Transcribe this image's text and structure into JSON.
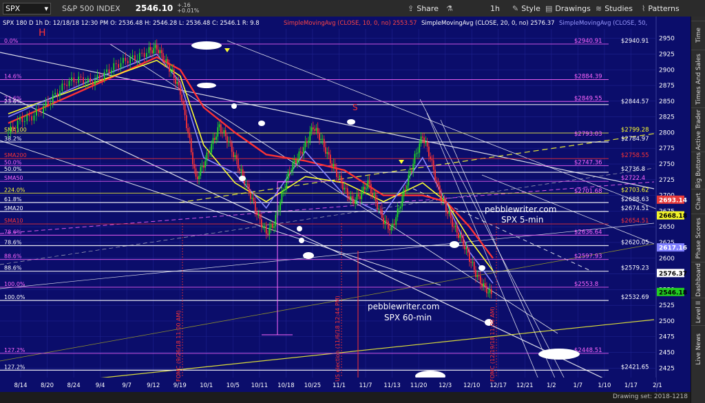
{
  "toolbar": {
    "symbol": "SPX",
    "name": "S&P 500 INDEX",
    "price": "2546.10",
    "change": "+.16",
    "change_pct": "+0.01%",
    "share": "Share",
    "interval": "1h",
    "style": "Style",
    "drawings": "Drawings",
    "studies": "Studies",
    "patterns": "Patterns"
  },
  "legend": {
    "ohlc": "SPX 180 D 1h   D: 12/18/18 12:30 PM   O: 2536.48   H: 2546.28   L: 2536.48   C: 2546.1   R: 9.8",
    "sma10": "SimpleMovingAvg (CLOSE, 10, 0, no)  2553.57",
    "sma20": "SimpleMovingAvg (CLOSE, 20, 0, no)  2576.37",
    "sma50": "SimpleMovingAvg (CLOSE, 50,"
  },
  "sidebar": {
    "tabs": [
      "Time",
      "Times And Sales",
      "Active Trader",
      "Big Buttons",
      "Chart",
      "Phase Scores",
      "Dashboard",
      "Level II",
      "Live News"
    ]
  },
  "status": {
    "drawing_set": "Drawing set: 2018-1218"
  },
  "annotations": {
    "h_mark": "H",
    "s_mark": "S",
    "watermark_5min": [
      "pebblewriter.com",
      "SPX 5-min"
    ],
    "watermark_60min": [
      "pebblewriter.com",
      "SPX 60-min"
    ],
    "fomc_sep": "FOMC (9/26/18 11:00 AM)",
    "us_election": "US election (11/6/18 12:44 PM)",
    "fomc_dec": "FOMC (12/19/18 11:00 AM)"
  },
  "chart_data": {
    "type": "candlestick",
    "ylim": [
      2410,
      2965
    ],
    "yticks": [
      2425,
      2450,
      2475,
      2500,
      2525,
      2550,
      2575,
      2600,
      2625,
      2650,
      2675,
      2700,
      2725,
      2750,
      2775,
      2800,
      2825,
      2850,
      2875,
      2900,
      2925,
      2950
    ],
    "xticks": [
      "8/14",
      "8/20",
      "8/24",
      "9/4",
      "9/7",
      "9/12",
      "9/19",
      "10/1",
      "10/5",
      "10/11",
      "10/18",
      "10/25",
      "11/1",
      "11/7",
      "11/13",
      "11/20",
      "12/3",
      "12/10",
      "12/17",
      "12/21",
      "1/2",
      "1/7",
      "1/10",
      "1/17",
      "2/1"
    ],
    "left_levels": [
      {
        "label": "0.0%",
        "value": 2940.91,
        "color": "#ff66ff"
      },
      {
        "label": "14.6%",
        "value": 2884.39,
        "color": "#ff66ff"
      },
      {
        "label": "23.6%",
        "value": 2849.55,
        "color": "#ff66ff"
      },
      {
        "label": "23.6%",
        "value": 2844.57,
        "color": "#ffffff"
      },
      {
        "label": "SMA100",
        "value": 2799.28,
        "color": "#ffff33"
      },
      {
        "label": "38.2%",
        "value": 2784.97,
        "color": "#ffffff"
      },
      {
        "label": "SMA200",
        "value": 2758.55,
        "color": "#ff3333"
      },
      {
        "label": "50.0%",
        "value": 2747.36,
        "color": "#ff66ff"
      },
      {
        "label": "50.0%",
        "value": 2736.8,
        "color": "#ffffff"
      },
      {
        "label": "SMA50",
        "value": 2722.4,
        "color": "#ff66ff"
      },
      {
        "label": "224.0%",
        "value": 2703.62,
        "color": "#ffff33"
      },
      {
        "label": "61.8%",
        "value": 2688.63,
        "color": "#ffffff"
      },
      {
        "label": "SMA20",
        "value": 2674.51,
        "color": "#ffffff"
      },
      {
        "label": "SMA10",
        "value": 2654.51,
        "color": "#ff3333"
      },
      {
        "label": "78.6%",
        "value": 2636.64,
        "color": "#ff66ff"
      },
      {
        "label": "78.6%",
        "value": 2620.05,
        "color": "#ffffff"
      },
      {
        "label": "88.6%",
        "value": 2597.93,
        "color": "#ff66ff"
      },
      {
        "label": "88.6%",
        "value": 2579.23,
        "color": "#ffffff"
      },
      {
        "label": "100.0%",
        "value": 2553.8,
        "color": "#ff66ff"
      },
      {
        "label": "100.0%",
        "value": 2532.69,
        "color": "#ffffff"
      },
      {
        "label": "127.2%",
        "value": 2448.51,
        "color": "#ff66ff"
      },
      {
        "label": "127.2%",
        "value": 2421.65,
        "color": "#ffffff"
      }
    ],
    "right_labels": [
      {
        "text": "$2940.91",
        "value": 2940.91,
        "color": "#ff66ff",
        "col": "a"
      },
      {
        "text": "$2940.91",
        "value": 2940.91,
        "color": "#ffffff",
        "col": "b"
      },
      {
        "text": "$2884.39",
        "value": 2884.39,
        "color": "#ff66ff",
        "col": "a"
      },
      {
        "text": "$2849.55",
        "value": 2849.55,
        "color": "#ff66ff",
        "col": "a"
      },
      {
        "text": "$2844.57",
        "value": 2844.57,
        "color": "#ffffff",
        "col": "b"
      },
      {
        "text": "$2799.28",
        "value": 2799.28,
        "color": "#ffff33",
        "col": "b"
      },
      {
        "text": "$2793.03",
        "value": 2793.03,
        "color": "#ff66ff",
        "col": "a"
      },
      {
        "text": "$2784.97",
        "value": 2784.97,
        "color": "#ffffff",
        "col": "b"
      },
      {
        "text": "$2758.55",
        "value": 2758.55,
        "color": "#ff3333",
        "col": "b"
      },
      {
        "text": "$2747.36",
        "value": 2747.36,
        "color": "#ff66ff",
        "col": "a"
      },
      {
        "text": "$2736.8",
        "value": 2736.8,
        "color": "#ffffff",
        "col": "b"
      },
      {
        "text": "$2722.4",
        "value": 2722.4,
        "color": "#ff66ff",
        "col": "b"
      },
      {
        "text": "$2703.62",
        "value": 2703.62,
        "color": "#ffff33",
        "col": "b"
      },
      {
        "text": "$2701.68",
        "value": 2701.68,
        "color": "#ff66ff",
        "col": "a"
      },
      {
        "text": "$2688.63",
        "value": 2688.63,
        "color": "#ffffff",
        "col": "b"
      },
      {
        "text": "$2674.51",
        "value": 2674.51,
        "color": "#ffffff",
        "col": "b"
      },
      {
        "text": "$2654.51",
        "value": 2654.51,
        "color": "#ff3333",
        "col": "b"
      },
      {
        "text": "$2636.64",
        "value": 2636.64,
        "color": "#ff66ff",
        "col": "a"
      },
      {
        "text": "$2620.05",
        "value": 2620.05,
        "color": "#ffffff",
        "col": "b"
      },
      {
        "text": "$2597.93",
        "value": 2597.93,
        "color": "#ff66ff",
        "col": "a"
      },
      {
        "text": "$2579.23",
        "value": 2579.23,
        "color": "#ffffff",
        "col": "b"
      },
      {
        "text": "$2553.8",
        "value": 2553.8,
        "color": "#ff66ff",
        "col": "a"
      },
      {
        "text": "$2532.69",
        "value": 2532.69,
        "color": "#ffffff",
        "col": "b"
      },
      {
        "text": "$2448.51",
        "value": 2448.51,
        "color": "#ff66ff",
        "col": "a"
      },
      {
        "text": "$2421.65",
        "value": 2421.65,
        "color": "#ffffff",
        "col": "b"
      }
    ],
    "axis_badges": [
      {
        "text": "2693.14",
        "value": 2693.14,
        "bg": "#e8393a",
        "fg": "#ffffff"
      },
      {
        "text": "2668.18",
        "value": 2668.18,
        "bg": "#f2f22a",
        "fg": "#000000"
      },
      {
        "text": "2617.16",
        "value": 2617.16,
        "bg": "#7f7fff",
        "fg": "#ffffff"
      },
      {
        "text": "2576.37",
        "value": 2576.37,
        "bg": "#ffffff",
        "fg": "#000000"
      },
      {
        "text": "2546.18",
        "value": 2546.18,
        "bg": "#22cc22",
        "fg": "#000000"
      }
    ],
    "price_path": [
      [
        0,
        2800
      ],
      [
        3,
        2820
      ],
      [
        6,
        2825
      ],
      [
        9,
        2840
      ],
      [
        12,
        2860
      ],
      [
        15,
        2880
      ],
      [
        18,
        2885
      ],
      [
        21,
        2880
      ],
      [
        24,
        2890
      ],
      [
        27,
        2905
      ],
      [
        30,
        2915
      ],
      [
        33,
        2920
      ],
      [
        36,
        2930
      ],
      [
        38,
        2935
      ],
      [
        40,
        2915
      ],
      [
        42,
        2895
      ],
      [
        44,
        2865
      ],
      [
        46,
        2800
      ],
      [
        48,
        2725
      ],
      [
        50,
        2750
      ],
      [
        52,
        2780
      ],
      [
        54,
        2810
      ],
      [
        56,
        2790
      ],
      [
        58,
        2760
      ],
      [
        60,
        2730
      ],
      [
        62,
        2700
      ],
      [
        64,
        2665
      ],
      [
        66,
        2640
      ],
      [
        68,
        2655
      ],
      [
        70,
        2700
      ],
      [
        72,
        2740
      ],
      [
        74,
        2760
      ],
      [
        76,
        2780
      ],
      [
        78,
        2810
      ],
      [
        80,
        2790
      ],
      [
        82,
        2760
      ],
      [
        84,
        2735
      ],
      [
        86,
        2710
      ],
      [
        88,
        2690
      ],
      [
        90,
        2700
      ],
      [
        92,
        2720
      ],
      [
        94,
        2690
      ],
      [
        96,
        2660
      ],
      [
        98,
        2645
      ],
      [
        100,
        2680
      ],
      [
        102,
        2720
      ],
      [
        104,
        2760
      ],
      [
        106,
        2795
      ],
      [
        108,
        2760
      ],
      [
        110,
        2710
      ],
      [
        112,
        2680
      ],
      [
        114,
        2650
      ],
      [
        116,
        2630
      ],
      [
        118,
        2600
      ],
      [
        120,
        2570
      ],
      [
        122,
        2552
      ],
      [
        124,
        2540
      ]
    ],
    "sma_series": [
      {
        "name": "SMA10",
        "color": "#ff3333",
        "points": [
          [
            0,
            2815
          ],
          [
            20,
            2870
          ],
          [
            38,
            2920
          ],
          [
            44,
            2900
          ],
          [
            50,
            2840
          ],
          [
            58,
            2800
          ],
          [
            66,
            2765
          ],
          [
            76,
            2755
          ],
          [
            86,
            2740
          ],
          [
            96,
            2700
          ],
          [
            106,
            2700
          ],
          [
            112,
            2690
          ],
          [
            118,
            2650
          ],
          [
            124,
            2600
          ]
        ]
      },
      {
        "name": "SMA20",
        "color": "#ffff33",
        "points": [
          [
            0,
            2830
          ],
          [
            20,
            2875
          ],
          [
            38,
            2915
          ],
          [
            44,
            2890
          ],
          [
            50,
            2780
          ],
          [
            58,
            2720
          ],
          [
            66,
            2690
          ],
          [
            76,
            2730
          ],
          [
            86,
            2720
          ],
          [
            96,
            2690
          ],
          [
            106,
            2720
          ],
          [
            112,
            2690
          ],
          [
            118,
            2630
          ],
          [
            124,
            2580
          ]
        ]
      },
      {
        "name": "SMA50",
        "color": "#8888ff",
        "points": [
          [
            0,
            2825
          ],
          [
            20,
            2880
          ],
          [
            38,
            2925
          ],
          [
            44,
            2880
          ],
          [
            50,
            2760
          ],
          [
            58,
            2735
          ],
          [
            66,
            2680
          ],
          [
            76,
            2770
          ],
          [
            86,
            2700
          ],
          [
            96,
            2670
          ],
          [
            106,
            2760
          ],
          [
            112,
            2690
          ],
          [
            118,
            2610
          ],
          [
            124,
            2560
          ]
        ]
      }
    ]
  }
}
